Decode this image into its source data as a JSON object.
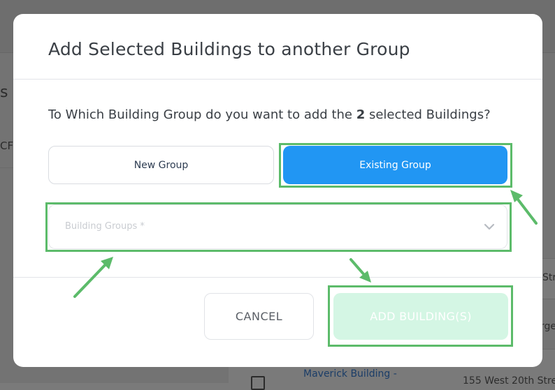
{
  "background": {
    "side_char": "s",
    "side_char2": "CF",
    "rows": [
      {
        "col2": "Str"
      },
      {
        "col2": "rge"
      },
      {
        "link": "Maverick Building -",
        "col2": "155 West 20th Stre"
      }
    ]
  },
  "modal": {
    "title": "Add Selected Buildings to another Group",
    "question_prefix": "To Which Building Group do you want to add the ",
    "question_count": "2",
    "question_suffix": " selected Buildings?",
    "new_group_label": "New Group",
    "existing_group_label": "Existing Group",
    "building_groups_placeholder": "Building Groups *",
    "cancel_label": "CANCEL",
    "add_label": "ADD BUILDING(S)"
  },
  "colors": {
    "primary": "#2196f3",
    "disabled_add": "#d4f6e4",
    "annotation": "#5cbb6a"
  },
  "icons": {
    "select_chevron": "chevron-down-icon"
  }
}
